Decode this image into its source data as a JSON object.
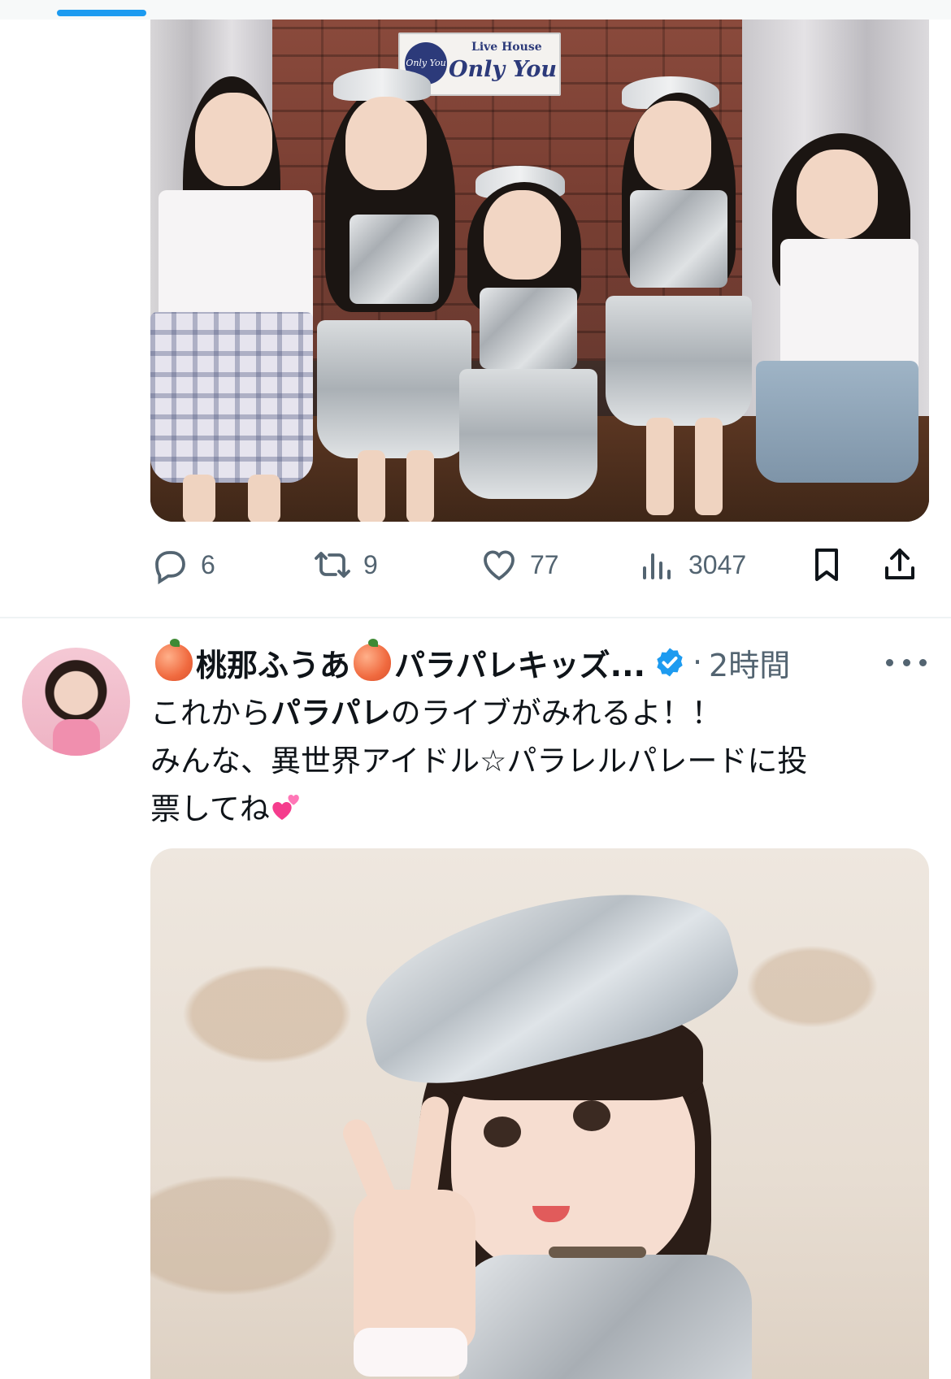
{
  "tweet1": {
    "media": {
      "venue_sign_sub": "Live House",
      "venue_sign_name": "Only You",
      "venue_logo_text": "Only You"
    },
    "actions": {
      "reply_count": "6",
      "retweet_count": "9",
      "like_count": "77",
      "views_count": "3047"
    }
  },
  "tweet2": {
    "author_name": "桃那ふうあ",
    "author_name_suffix": "パラパレキッズ...",
    "separator": "·",
    "time": "2時間",
    "body_line1_pre": "これから",
    "body_line1_bold": "パラパレ",
    "body_line1_post": "のライブがみれるよ！！",
    "body_line2": "みんな、異世界アイドル☆パラレルパレードに投",
    "body_line3": "票してね"
  },
  "colors": {
    "accent": "#1d9bf0",
    "secondary_text": "#536471",
    "primary_text": "#0f1419",
    "divider": "#eff3f4"
  },
  "icons": {
    "reply": "reply-icon",
    "retweet": "retweet-icon",
    "like": "heart-icon",
    "views": "views-icon",
    "bookmark": "bookmark-icon",
    "share": "share-icon",
    "verified": "verified-badge-icon",
    "more": "more-icon",
    "emoji_peach": "peach-emoji-icon",
    "emoji_hearts": "two-hearts-emoji-icon"
  }
}
